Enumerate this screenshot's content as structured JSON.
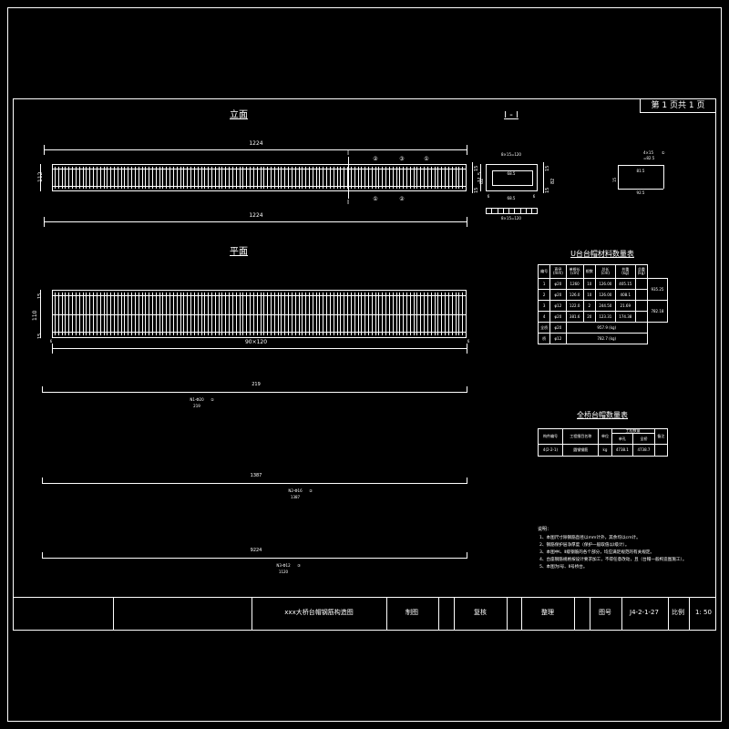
{
  "sheet": {
    "page_label": "第 1 页共 1 页",
    "title_block": {
      "drawing_title": "xxx大桥台帽钢筋构造图",
      "cells": [
        "制图",
        "复核",
        "整理"
      ],
      "number_label": "图号",
      "number_value": "J4-2-1-27",
      "scale_label": "比例",
      "scale_value": "1: 50"
    }
  },
  "views": {
    "elevation": {
      "title": "立面",
      "top_dim": "1224",
      "bottom_dim": "1224",
      "left_dim": "112",
      "right_dims": [
        "15",
        "82",
        "15"
      ],
      "section_marks": [
        "I",
        "I"
      ],
      "callouts": [
        "②",
        "③",
        "①"
      ],
      "labels_right": [
        "①",
        "②"
      ]
    },
    "section": {
      "title": "I - I",
      "top_label": "8×15=120",
      "bottom_label": "8×15=120",
      "inner_dim": "68.5",
      "left_dims": [
        "11.5",
        "112"
      ],
      "right_dims": [
        "15",
        "82",
        "15"
      ],
      "bottom_dims": [
        "6",
        "68.5",
        "6"
      ]
    },
    "detail": {
      "labels": [
        "4×15",
        "=82.5",
        "①",
        "81.5",
        "92.5"
      ],
      "left_dim": "15"
    },
    "plan": {
      "title": "平面",
      "left_dims": [
        "15",
        "110",
        "15"
      ],
      "bottom_dim": "90×120",
      "right_marks": [
        "6",
        "6"
      ]
    },
    "bars": [
      {
        "length_top": "219",
        "label_top": "N1-Φ20",
        "label_bot": "219",
        "mark": "①"
      },
      {
        "length_top": "1387",
        "label_top": "N2-Φ16",
        "label_bot": "1387",
        "mark": "②"
      },
      {
        "length_top": "9224",
        "label_top": "N3-Φ12",
        "label_bot": "1120",
        "mark": "③"
      }
    ]
  },
  "table_material": {
    "title": "U台台帽材料数量表",
    "headers": [
      "编号",
      "直径 (mm)",
      "单根长 (cm)",
      "根数",
      "总长 (cm)",
      "共重 (kg)",
      "总重 (kg)"
    ],
    "rows": [
      [
        "1",
        "φ20",
        "1260",
        "10",
        "126.00",
        "405.15",
        ""
      ],
      [
        "2",
        "φ20",
        "126.0",
        "10",
        "126.00",
        "408.1",
        ""
      ],
      [
        "3",
        "φ12",
        "122.0",
        "2",
        "244.50",
        "21.69",
        ""
      ],
      [
        "4",
        "φ20",
        "381.6",
        "20",
        "123.31",
        "174.38",
        ""
      ]
    ],
    "footer_rows": [
      [
        "全桥",
        "φ20",
        "957.9  (kg)"
      ],
      [
        "桥",
        "φ12",
        "782.7  (kg)"
      ]
    ],
    "total_right": [
      "935.25",
      "782.18"
    ]
  },
  "table_quantity": {
    "title": "全桥台帽数量表",
    "headers": [
      "构件编号",
      "工程细目名称",
      "单位",
      "工程数量",
      "备注"
    ],
    "sub_headers": [
      "单孔",
      "全桥"
    ],
    "rows": [
      [
        "4(2-2-1)",
        "圆钢钢筋",
        "kg",
        "4738.1",
        "4738.7",
        ""
      ]
    ]
  },
  "notes": {
    "title": "说明：",
    "items": [
      "1、本图尺寸除钢筋直径以mm计外，其余均以cm计。",
      "2、钢筋保护层净厚度（保护一般取值以Ⅰ级计）。",
      "3、本图中Ⅰ、Ⅱ级钢筋的各个部分，均应满足规范的有关规定。",
      "4、台座钢筋规格按设计要求加工，不得任意改动，且（台帽一般构造图施工）。",
      "5、本图为Ⅰ号、Ⅱ号桥台。"
    ]
  }
}
